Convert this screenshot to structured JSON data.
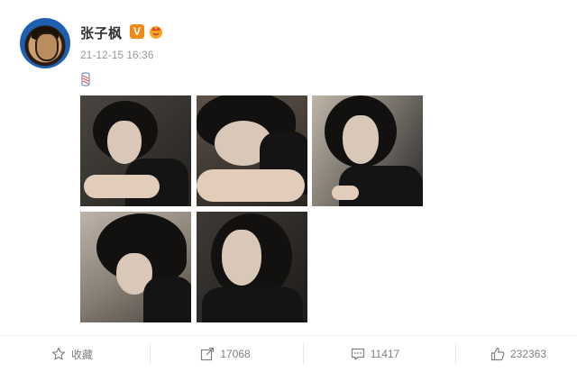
{
  "post": {
    "username": "张子枫",
    "verified_badge": "V",
    "timestamp": "21-12-15 16:36",
    "content_icon": "pencil-emoji-icon",
    "photos": [
      {
        "name": "photo-1",
        "icon": "portrait-image"
      },
      {
        "name": "photo-2",
        "icon": "portrait-image"
      },
      {
        "name": "photo-3",
        "icon": "portrait-image"
      },
      {
        "name": "photo-4",
        "icon": "portrait-image"
      },
      {
        "name": "photo-5",
        "icon": "portrait-image"
      }
    ]
  },
  "actions": {
    "favorite_label": "收藏",
    "repost_count": "17068",
    "comment_count": "11417",
    "like_count": "232363"
  },
  "colors": {
    "accent_orange": "#f08a1b",
    "muted_text": "#808080",
    "name_text": "#333333"
  }
}
